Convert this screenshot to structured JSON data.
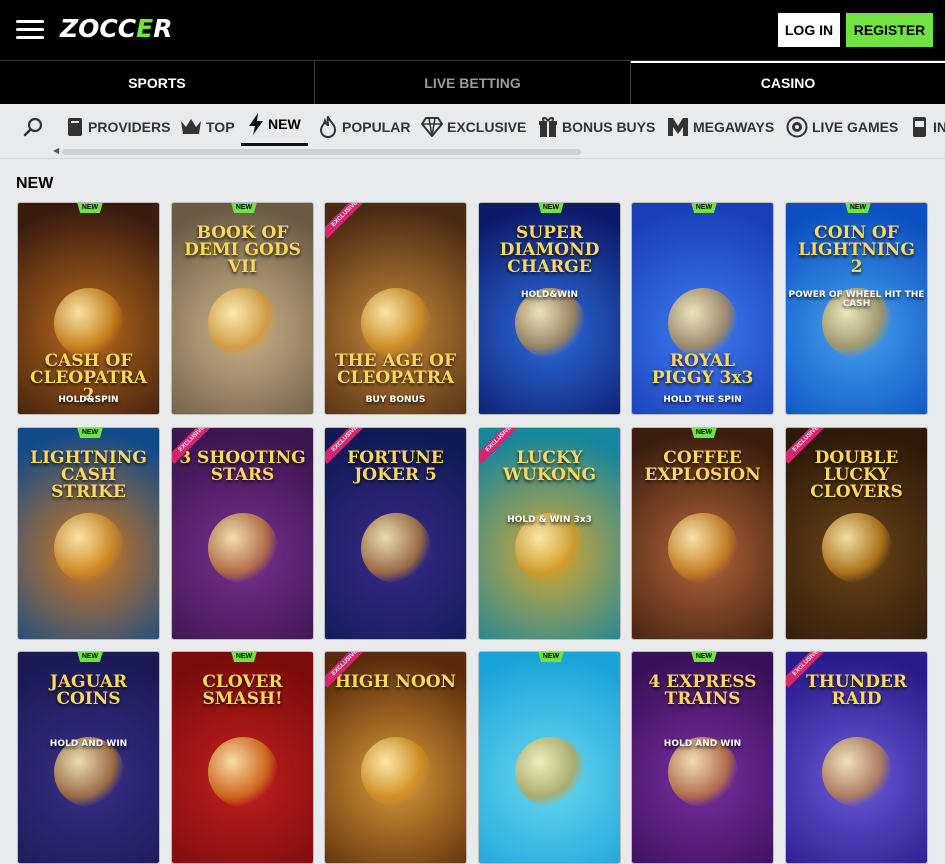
{
  "header": {
    "logo_text": "ZOCCER",
    "login_label": "LOG IN",
    "register_label": "REGISTER"
  },
  "mainnav": {
    "tabs": [
      {
        "label": "SPORTS"
      },
      {
        "label": "LIVE BETTING"
      },
      {
        "label": "CASINO"
      }
    ],
    "active": "CASINO"
  },
  "categories": [
    {
      "label": "PROVIDERS",
      "icon": "book-icon"
    },
    {
      "label": "TOP",
      "icon": "crown-icon"
    },
    {
      "label": "NEW",
      "icon": "lightning-icon"
    },
    {
      "label": "POPULAR",
      "icon": "flame-icon"
    },
    {
      "label": "EXCLUSIVE",
      "icon": "diamond-icon"
    },
    {
      "label": "BONUS BUYS",
      "icon": "gift-icon"
    },
    {
      "label": "MEGAWAYS",
      "icon": "megaways-icon"
    },
    {
      "label": "LIVE GAMES",
      "icon": "live-games-icon"
    },
    {
      "label": "IN",
      "icon": "slot-machine-icon"
    }
  ],
  "section": {
    "title": "NEW"
  },
  "badges": {
    "new": "NEW",
    "exclusive": "EXCLUSIVE"
  },
  "games": [
    {
      "title": "CASH OF CLEOPATRA 2",
      "subtitle": "HOLD&SPIN",
      "badge": "new",
      "colors": [
        "#3a1c0e",
        "#b86a1c"
      ]
    },
    {
      "title": "BOOK OF DEMI GODS VII",
      "subtitle": "",
      "badge": "new",
      "colors": [
        "#6b5a44",
        "#cbb48a"
      ]
    },
    {
      "title": "THE AGE OF CLEOPATRA",
      "subtitle": "BUY BONUS",
      "badge": "exclusive",
      "colors": [
        "#4a2a12",
        "#c88a3a"
      ]
    },
    {
      "title": "SUPER DIAMOND CHARGE",
      "subtitle": "HOLD&WIN",
      "badge": "new",
      "colors": [
        "#0d1a6a",
        "#2d6fe0"
      ]
    },
    {
      "title": "ROYAL PIGGY 3x3",
      "subtitle": "HOLD THE SPIN",
      "badge": "new",
      "colors": [
        "#1a3fb8",
        "#3d7af0"
      ]
    },
    {
      "title": "COIN OF LIGHTNING 2",
      "subtitle": "POWER OF WHEEL HIT THE CASH",
      "badge": "new",
      "colors": [
        "#0b4fc0",
        "#46a3f0"
      ]
    },
    {
      "title": "LIGHTNING CASH STRIKE",
      "subtitle": "",
      "badge": "new",
      "colors": [
        "#134a8a",
        "#d47a1e"
      ]
    },
    {
      "title": "3 SHOOTING STARS",
      "subtitle": "",
      "badge": "exclusive",
      "colors": [
        "#3b1550",
        "#7a2f8f"
      ]
    },
    {
      "title": "FORTUNE JOKER 5",
      "subtitle": "",
      "badge": "exclusive",
      "colors": [
        "#0f1a55",
        "#3b2a8a"
      ]
    },
    {
      "title": "LUCKY WUKONG",
      "subtitle": "HOLD & WIN 3x3",
      "badge": "exclusive",
      "colors": [
        "#1486a0",
        "#d7a72f"
      ]
    },
    {
      "title": "COFFEE EXPLOSION",
      "subtitle": "",
      "badge": "new",
      "colors": [
        "#3a1d0c",
        "#b4653a"
      ]
    },
    {
      "title": "DOUBLE LUCKY CLOVERS",
      "subtitle": "",
      "badge": "exclusive",
      "colors": [
        "#2d1a0a",
        "#6a4416"
      ]
    },
    {
      "title": "JAGUAR COINS",
      "subtitle": "HOLD AND WIN",
      "badge": "new",
      "colors": [
        "#1a1a55",
        "#3a2f8a"
      ]
    },
    {
      "title": "CLOVER SMASH!",
      "subtitle": "",
      "badge": "new",
      "colors": [
        "#7a0c0c",
        "#c21e1e"
      ]
    },
    {
      "title": "HIGH NOON",
      "subtitle": "",
      "badge": "exclusive",
      "colors": [
        "#5a2a0a",
        "#d79a3a"
      ]
    },
    {
      "title": "",
      "subtitle": "",
      "badge": "new",
      "colors": [
        "#1aa3d8",
        "#6ad8f0"
      ]
    },
    {
      "title": "4 EXPRESS TRAINS",
      "subtitle": "HOLD AND WIN",
      "badge": "new",
      "colors": [
        "#3a0f5a",
        "#7a2fa0"
      ]
    },
    {
      "title": "THUNDER RAID",
      "subtitle": "",
      "badge": "exclusive",
      "colors": [
        "#2a1a8a",
        "#6a5ad8"
      ]
    }
  ]
}
